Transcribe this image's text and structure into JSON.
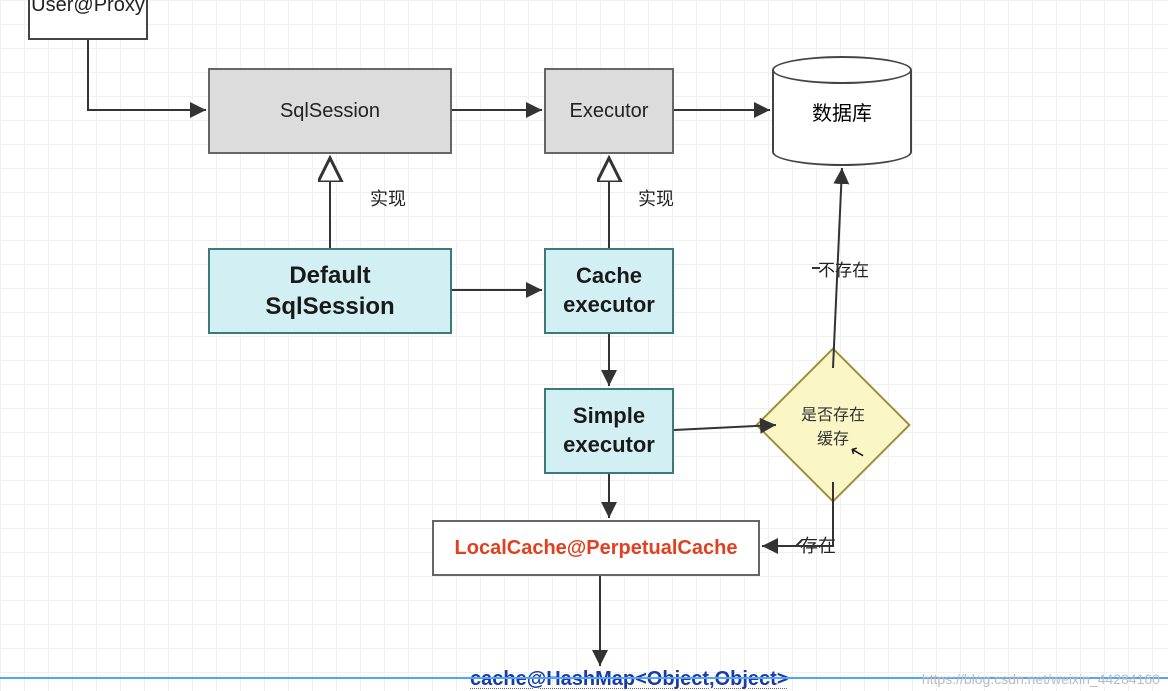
{
  "nodes": {
    "user_proxy": "User@Proxy",
    "sql_session": "SqlSession",
    "executor": "Executor",
    "database": "数据库",
    "default_sql_session": "Default\nSqlSession",
    "cache_executor": "Cache\nexecutor",
    "simple_executor": "Simple\nexecutor",
    "local_cache": "LocalCache@PerpetualCache",
    "hashmap": "cache@HashMap<Object,Object>",
    "cache_check": "是否存在\n缓存"
  },
  "labels": {
    "implement_1": "实现",
    "implement_2": "实现",
    "not_exist": "不存在",
    "exist": "存在"
  },
  "watermark": "https://blog.csdn.net/weixin_44284160"
}
